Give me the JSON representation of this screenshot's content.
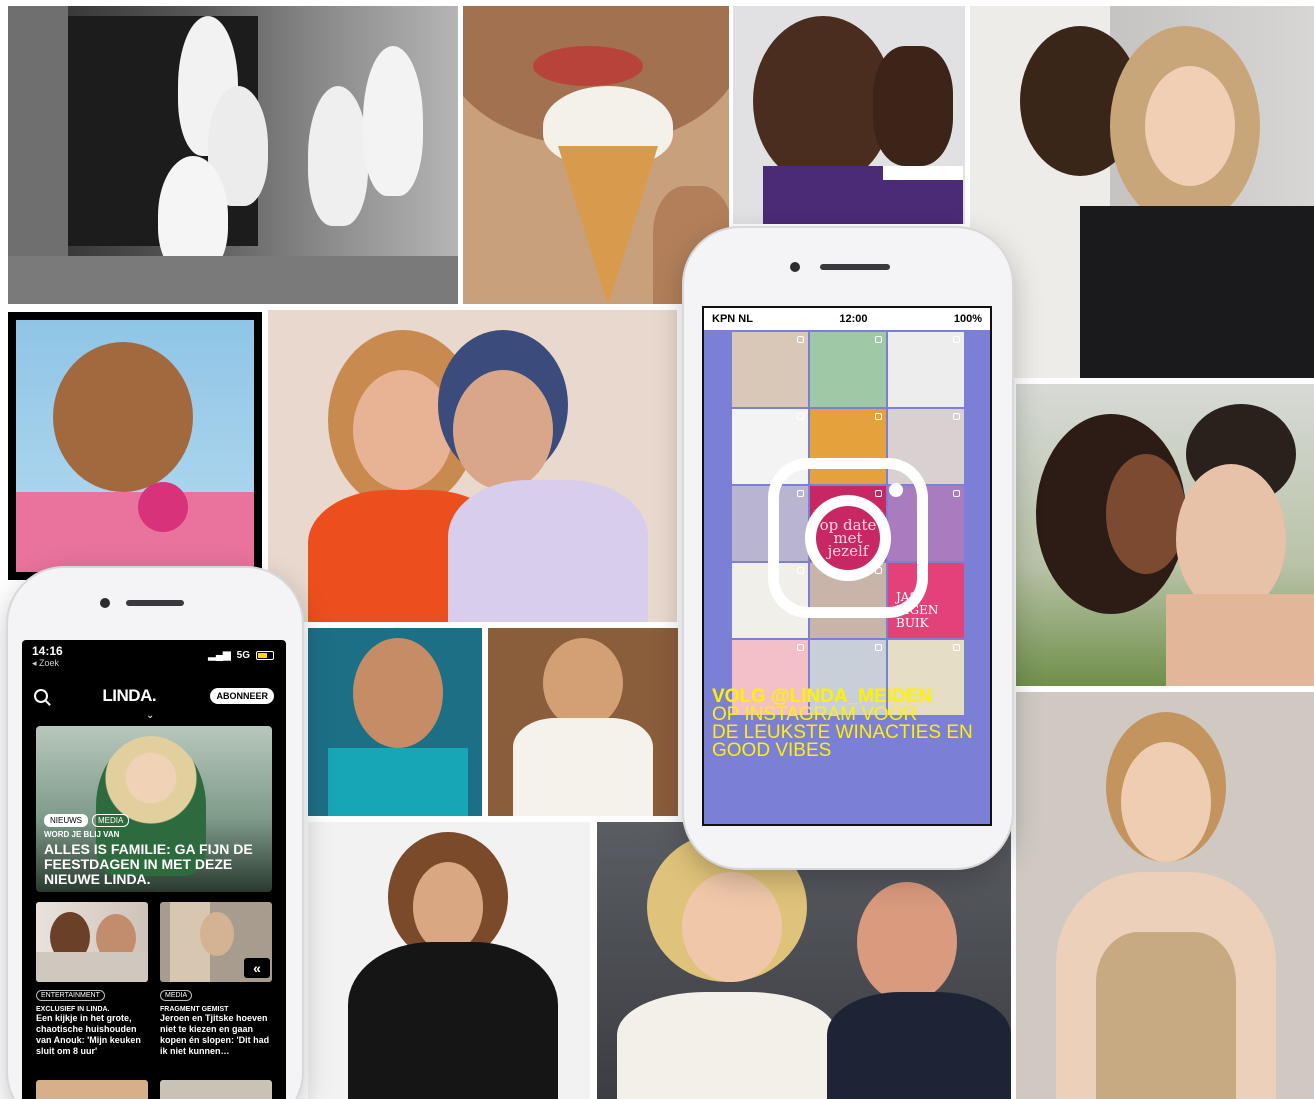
{
  "instagram_phone": {
    "carrier": "KPN NL",
    "time": "12:00",
    "battery": "100%",
    "logo_text": "op date met jezelf",
    "promo_title": "VOLG @LINDA_MEIDEN",
    "promo_line1": "OP INSTAGRAM VOOR",
    "promo_line2": "DE LEUKSTE WINACTIES EN",
    "promo_line3": "GOOD VIBES",
    "tile_text_buik": "JAS EIGEN BUIK"
  },
  "linda_phone": {
    "time": "14:16",
    "back_label": "◂ Zoek",
    "network": "5G",
    "logo": "LINDA.",
    "subscribe_label": "ABONNEER",
    "hero": {
      "tag1": "NIEUWS",
      "tag2": "MEDIA",
      "kicker": "WORD JE BLIJ VAN",
      "headline": "ALLES IS FAMILIE: GA FIJN DE FEESTDAGEN IN MET DEZE NIEUWE LINDA."
    },
    "cards": [
      {
        "tag": "ENTERTAINMENT",
        "kicker": "EXCLUSIEF IN LINDA.",
        "title": "Een kijkje in het grote, chaotische huishouden van Anouk: 'Mijn keuken sluit om 8 uur'"
      },
      {
        "tag": "MEDIA",
        "kicker": "FRAGMENT GEMIST",
        "title": "Jeroen en Tjitske hoeven niet te kiezen en gaan kopen én slopen: 'Dit had ik niet kunnen…"
      }
    ]
  },
  "colors": {
    "ig_background": "#7c7fd6",
    "ig_text_yellow": "#fff200",
    "linda_black": "#000000",
    "battery_yellow": "#ffd800"
  }
}
